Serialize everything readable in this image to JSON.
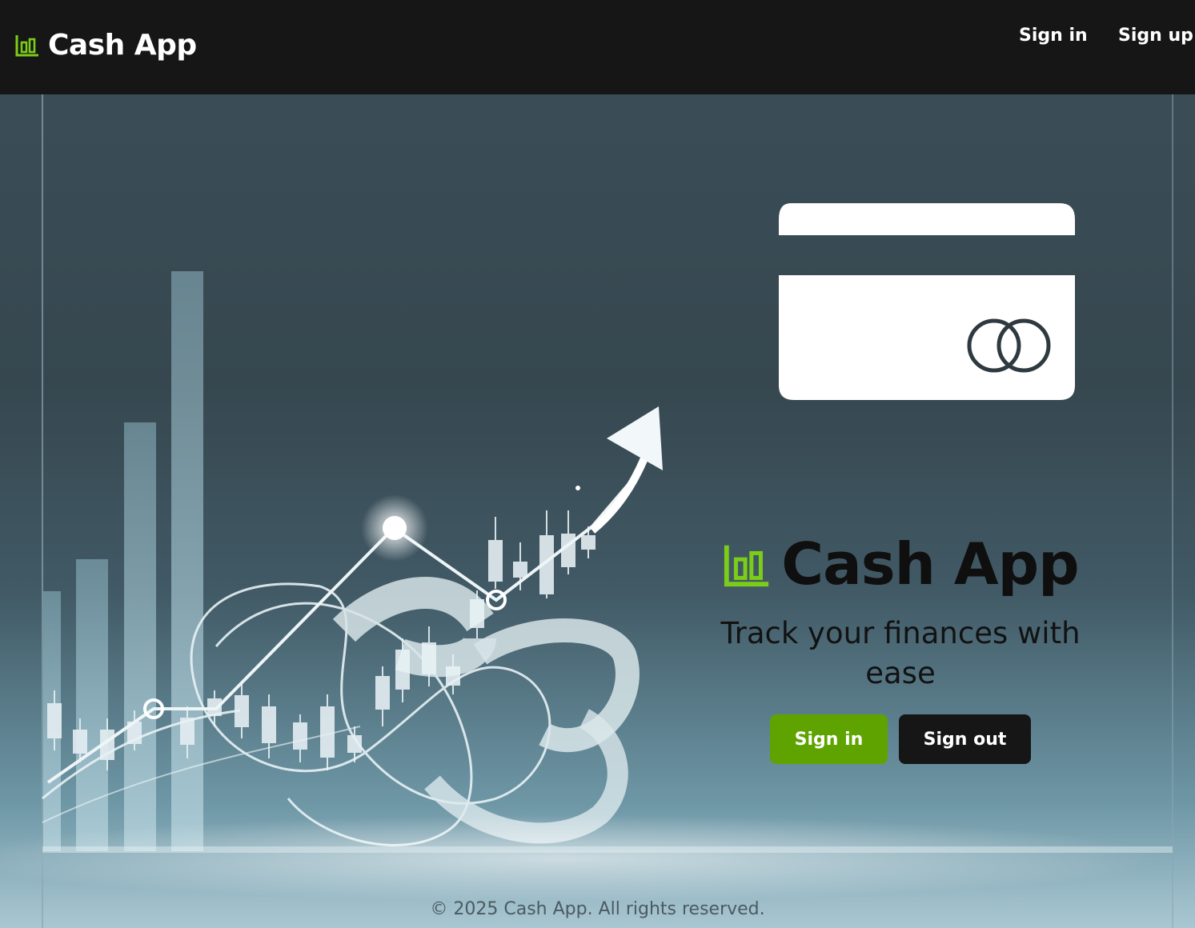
{
  "app": {
    "name": "Cash App",
    "accent_color": "#5fa300"
  },
  "navbar": {
    "brand_icon": "bar-chart-icon",
    "brand_text": "Cash App",
    "links": [
      {
        "label": "Sign in"
      },
      {
        "label": "Sign up"
      }
    ]
  },
  "hero": {
    "card_icon": "credit-card-icon",
    "card_logo": "interlocking-rings-icon",
    "brand_icon": "bar-chart-icon",
    "title": "Cash App",
    "tagline": "Track your finances with ease",
    "buttons": {
      "signin": "Sign in",
      "signout": "Sign out"
    }
  },
  "footer": {
    "text": "© 2025 Cash App. All rights reserved."
  }
}
